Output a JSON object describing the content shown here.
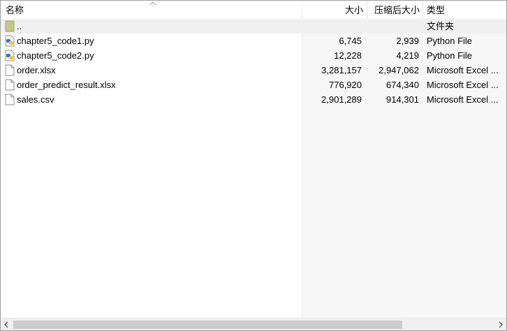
{
  "columns": {
    "name": "名称",
    "size": "大小",
    "packed": "压缩后大小",
    "type": "类型"
  },
  "rows": [
    {
      "icon": "folder-up-icon",
      "name": "..",
      "size": "",
      "packed": "",
      "type": "文件夹"
    },
    {
      "icon": "python-file-icon",
      "name": "chapter5_code1.py",
      "size": "6,745",
      "packed": "2,939",
      "type": "Python File"
    },
    {
      "icon": "python-file-icon",
      "name": "chapter5_code2.py",
      "size": "12,228",
      "packed": "4,219",
      "type": "Python File"
    },
    {
      "icon": "document-icon",
      "name": "order.xlsx",
      "size": "3,281,157",
      "packed": "2,947,062",
      "type": "Microsoft Excel ..."
    },
    {
      "icon": "document-icon",
      "name": "order_predict_result.xlsx",
      "size": "776,920",
      "packed": "674,340",
      "type": "Microsoft Excel ..."
    },
    {
      "icon": "document-icon",
      "name": "sales.csv",
      "size": "2,901,289",
      "packed": "914,301",
      "type": "Microsoft Excel ..."
    }
  ],
  "colors": {
    "selected_row": "#f0f0f0",
    "folder": "#c3c88a",
    "python_blue": "#3a75b0",
    "python_yellow": "#f2c52a",
    "scroll_thumb": "#cdcdcd"
  }
}
